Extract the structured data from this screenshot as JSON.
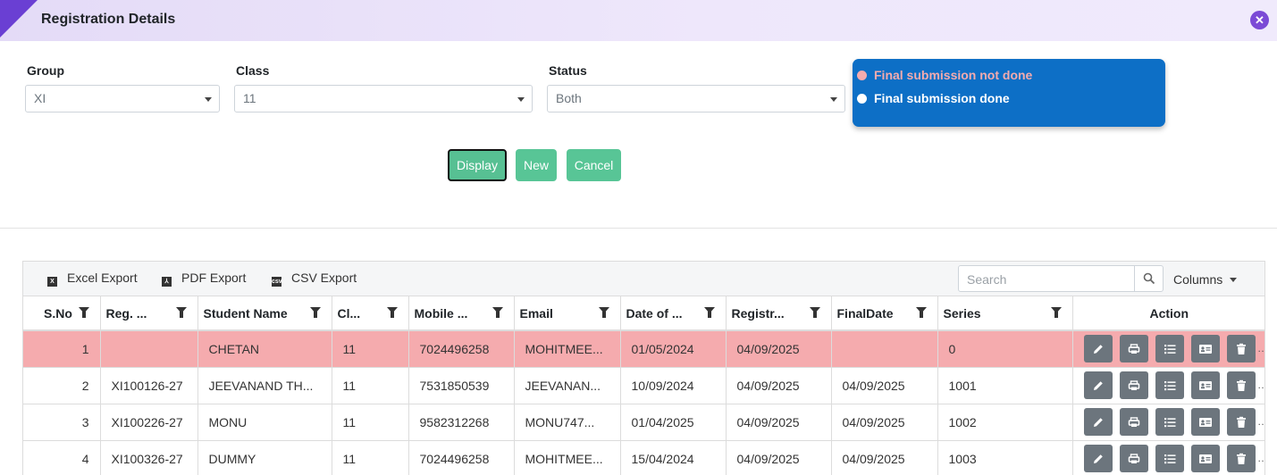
{
  "header": {
    "title": "Registration Details"
  },
  "filters": {
    "group": {
      "label": "Group",
      "value": "XI"
    },
    "class": {
      "label": "Class",
      "value": "11"
    },
    "status": {
      "label": "Status",
      "value": "Both"
    }
  },
  "legend": {
    "items": [
      {
        "label": "Final submission not done",
        "color": "#f5abae"
      },
      {
        "label": "Final submission done",
        "color": "#ffffff"
      }
    ]
  },
  "buttons": {
    "display": "Display",
    "new": "New",
    "cancel": "Cancel"
  },
  "toolbar": {
    "excel": "Excel Export",
    "pdf": "PDF Export",
    "csv": "CSV Export",
    "search_placeholder": "Search",
    "columns": "Columns"
  },
  "table": {
    "headers": [
      "S.No",
      "Reg. ...",
      "Student Name",
      "Cl...",
      "Mobile ...",
      "Email",
      "Date of ...",
      "Registr...",
      "FinalDate",
      "Series",
      "Action"
    ],
    "rows": [
      {
        "sno": "1",
        "reg": "",
        "name": "CHETAN",
        "cls": "11",
        "mobile": "7024496258",
        "email": "MOHITMEE...",
        "dob": "01/05/2024",
        "regdate": "04/09/2025",
        "finaldate": "",
        "series": "0"
      },
      {
        "sno": "2",
        "reg": "XI100126-27",
        "name": "JEEVANAND TH...",
        "cls": "11",
        "mobile": "7531850539",
        "email": "JEEVANAN...",
        "dob": "10/09/2024",
        "regdate": "04/09/2025",
        "finaldate": "04/09/2025",
        "series": "1001"
      },
      {
        "sno": "3",
        "reg": "XI100226-27",
        "name": "MONU",
        "cls": "11",
        "mobile": "9582312268",
        "email": "MONU747...",
        "dob": "01/04/2025",
        "regdate": "04/09/2025",
        "finaldate": "04/09/2025",
        "series": "1002"
      },
      {
        "sno": "4",
        "reg": "XI100326-27",
        "name": "DUMMY",
        "cls": "11",
        "mobile": "7024496258",
        "email": "MOHITMEE...",
        "dob": "15/04/2024",
        "regdate": "04/09/2025",
        "finaldate": "04/09/2025",
        "series": "1003"
      }
    ]
  },
  "icons": {
    "close": "close-icon",
    "edit": "pencil-icon",
    "print": "printer-icon",
    "list": "list-icon",
    "card": "id-card-icon",
    "delete": "trash-icon"
  }
}
